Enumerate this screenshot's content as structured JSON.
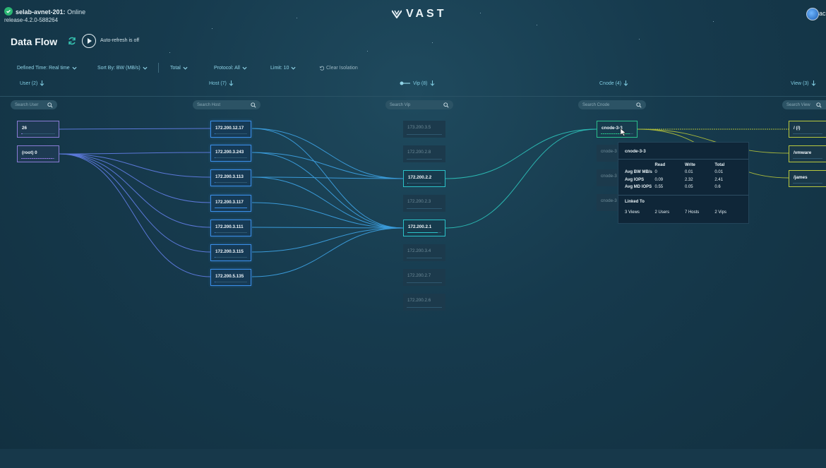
{
  "header": {
    "cluster_name": "selab-avnet-201:",
    "cluster_state": "Online",
    "release": "release-4.2.0-588264",
    "logo_text": "VAST",
    "user_initials": "ac"
  },
  "page": {
    "title": "Data Flow",
    "autorefresh_label": "Auto-refresh is off"
  },
  "filters": {
    "defined_time": "Defined Time: Real time",
    "sort_by": "Sort By: BW (MB/s)",
    "total": "Total",
    "protocol": "Protocol: All",
    "limit": "Limit: 10",
    "clear_isolation": "Clear Isolation"
  },
  "columns": {
    "user": {
      "label": "User (2)",
      "search_placeholder": "Search User"
    },
    "host": {
      "label": "Host (7)",
      "search_placeholder": "Search Host"
    },
    "vip": {
      "label": "Vip (8)",
      "search_placeholder": "Search Vip"
    },
    "cnode": {
      "label": "Cnode (4)",
      "search_placeholder": "Search Cnode"
    },
    "view": {
      "label": "View (3)",
      "search_placeholder": "Search View"
    }
  },
  "users": [
    "26",
    "(root) 0"
  ],
  "hosts": [
    "172.200.12.17",
    "172.200.3.243",
    "172.200.3.113",
    "172.200.3.117",
    "172.200.3.111",
    "172.200.3.115",
    "172.200.5.135"
  ],
  "vips": [
    "173.200.3.5",
    "172.200.2.8",
    "172.200.2.2",
    "172.200.2.3",
    "172.200.2.1",
    "172.200.3.4",
    "172.200.2.7",
    "172.200.2.6"
  ],
  "cnodes": [
    "cnode-3-3",
    "cnode-3",
    "cnode-3",
    "cnode-3"
  ],
  "views": [
    "/ (/)",
    "/vmware",
    "/james"
  ],
  "tooltip": {
    "title": "cnode-3-3",
    "headers": [
      "",
      "Read",
      "Write",
      "Total"
    ],
    "rows": [
      [
        "Avg BW MB/s",
        "0",
        "0.01",
        "0.01"
      ],
      [
        "Avg IOPS",
        "0.09",
        "2.32",
        "2.41"
      ],
      [
        "Avg MD IOPS",
        "0.55",
        "0.05",
        "0.6"
      ]
    ],
    "linked_title": "Linked To",
    "linked": [
      "3  Views",
      "2  Users",
      "7  Hosts",
      "2  Vips"
    ]
  },
  "colors": {
    "user_border": "#8a7cd6",
    "host_border": "#3a8ee8",
    "vip_active_border": "#2bc3c9",
    "cnode_border": "#2bc08d",
    "view_border": "#b9c83e",
    "accent_teal": "#37c6b3"
  }
}
